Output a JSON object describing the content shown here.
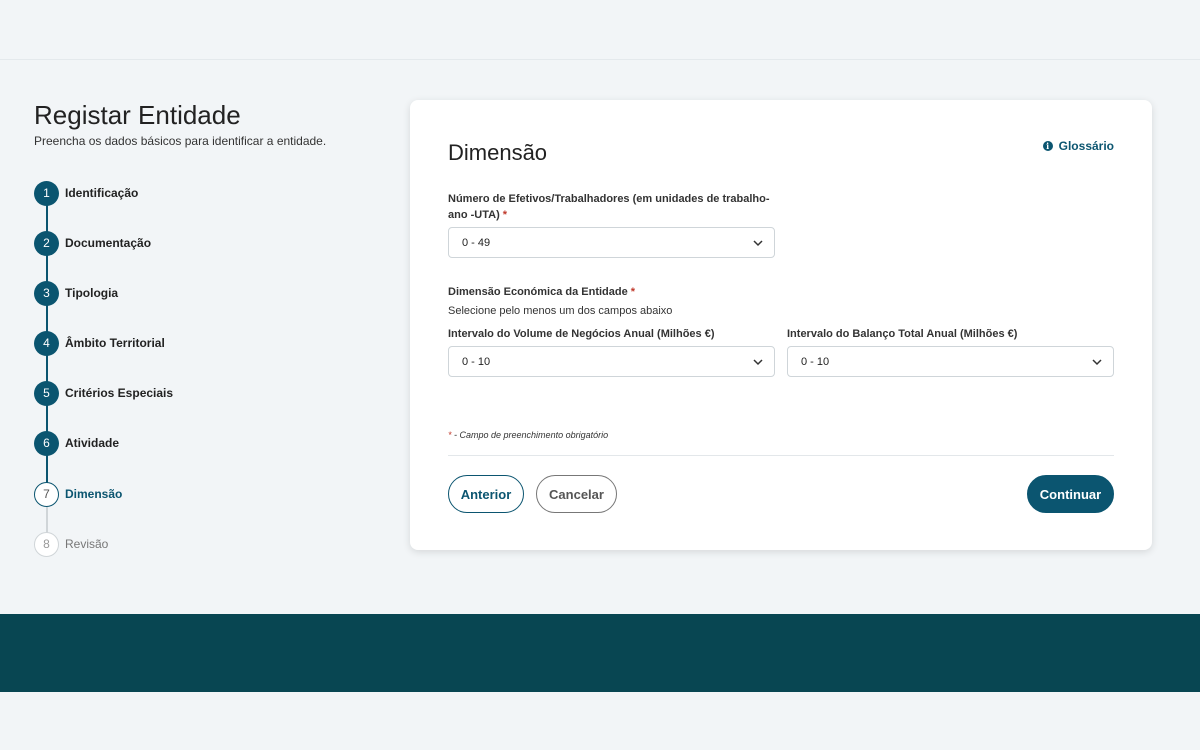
{
  "header": {
    "title": "Registar Entidade",
    "subtitle": "Preencha os dados básicos para identificar a entidade."
  },
  "steps": [
    {
      "number": "1",
      "label": "Identificação",
      "state": "done"
    },
    {
      "number": "2",
      "label": "Documentação",
      "state": "done"
    },
    {
      "number": "3",
      "label": "Tipologia",
      "state": "done"
    },
    {
      "number": "4",
      "label": "Âmbito Territorial",
      "state": "done"
    },
    {
      "number": "5",
      "label": "Critérios Especiais",
      "state": "done"
    },
    {
      "number": "6",
      "label": "Atividade",
      "state": "done"
    },
    {
      "number": "7",
      "label": "Dimensão",
      "state": "current"
    },
    {
      "number": "8",
      "label": "Revisão",
      "state": "pending"
    }
  ],
  "form": {
    "title": "Dimensão",
    "glossary_label": "Glossário",
    "workers": {
      "label_line1": "Número de Efetivos/Trabalhadores (em unidades de trabalho-",
      "label_line2": "ano -UTA)",
      "required_mark": "*",
      "value": "0 - 49"
    },
    "economic": {
      "label": "Dimensão Económica da Entidade",
      "required_mark": "*",
      "helper": "Selecione pelo menos um dos campos abaixo",
      "turnover": {
        "label": "Intervalo do Volume de Negócios Anual (Milhões €)",
        "value": "0 - 10"
      },
      "balance": {
        "label": "Intervalo do Balanço Total Anual (Milhões €)",
        "value": "0 - 10"
      }
    },
    "required_note_mark": "*",
    "required_note": " - Campo de preenchimento obrigatório",
    "buttons": {
      "previous": "Anterior",
      "cancel": "Cancelar",
      "continue": "Continuar"
    }
  },
  "colors": {
    "primary": "#0b5570",
    "footer": "#084652",
    "required": "#c0392b"
  },
  "icons": {
    "glossary": "info-icon",
    "select": "chevron-down-icon"
  }
}
